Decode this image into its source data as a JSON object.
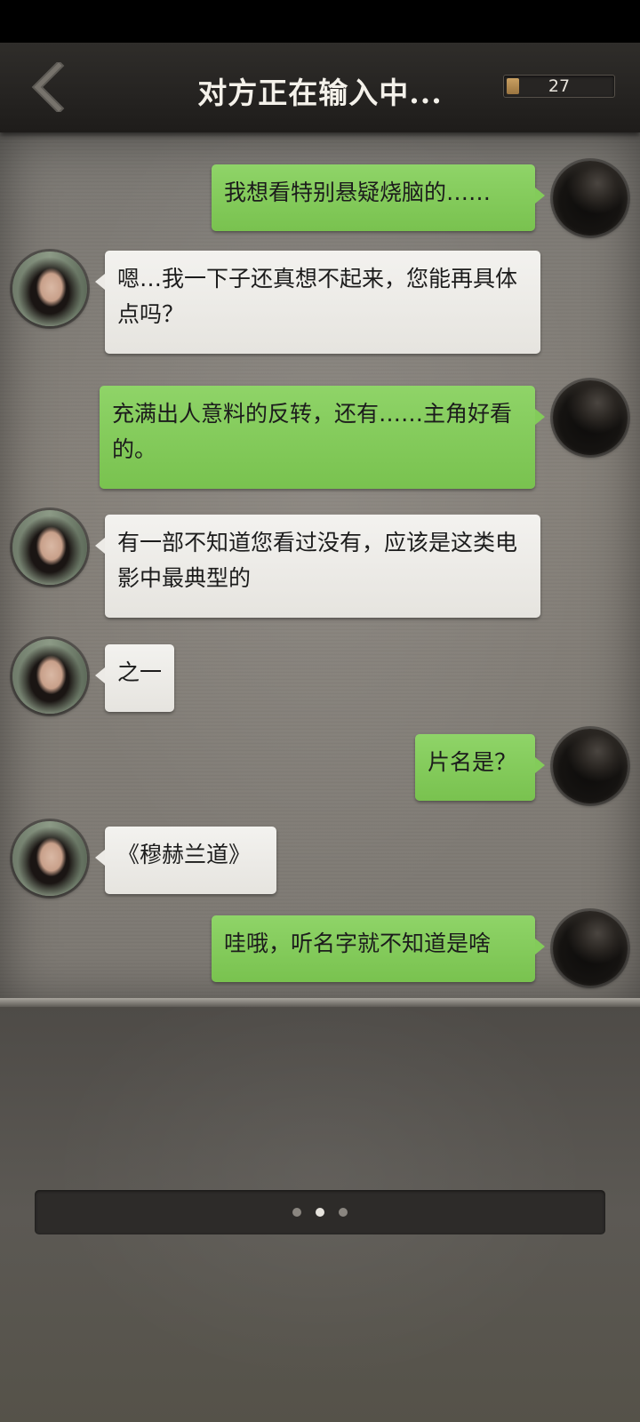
{
  "header": {
    "title": "对方正在输入中...",
    "back_icon": "chevron-left-icon",
    "counter_icon": "coin-icon",
    "counter_value": "27"
  },
  "messages": [
    {
      "side": "right",
      "text": "我想看特别悬疑烧脑的……"
    },
    {
      "side": "left",
      "text": "嗯…我一下子还真想不起来，您能再具体点吗？"
    },
    {
      "side": "right",
      "text": "充满出人意料的反转，还有……主角好看的。"
    },
    {
      "side": "left",
      "text": "有一部不知道您看过没有，应该是这类电影中最典型的"
    },
    {
      "side": "left",
      "text": "之一"
    },
    {
      "side": "right",
      "text": "片名是？"
    },
    {
      "side": "left",
      "text": "《穆赫兰道》"
    },
    {
      "side": "right",
      "text": "哇哦，听名字就不知道是啥"
    }
  ],
  "typing_indicator": {
    "dots": 3,
    "active_dot": 2
  },
  "colors": {
    "sent_bubble": "#82ca59",
    "received_bubble": "#eceae6",
    "header_bg": "#262422"
  }
}
